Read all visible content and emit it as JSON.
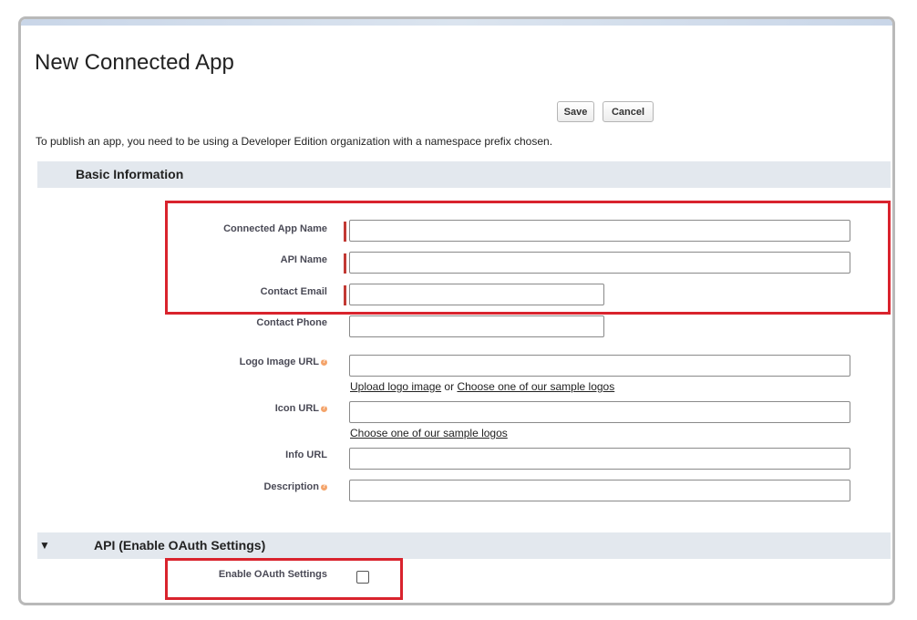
{
  "page": {
    "title": "New Connected App",
    "notice": "To publish an app, you need to be using a Developer Edition organization with a namespace prefix chosen."
  },
  "buttons": {
    "save": "Save",
    "cancel": "Cancel"
  },
  "sections": {
    "basic": {
      "title": "Basic Information"
    },
    "api": {
      "title": "API (Enable OAuth Settings)",
      "collapse_icon": "triangle-down-icon",
      "expanded": true
    }
  },
  "fields": {
    "connected_app_name": {
      "label": "Connected App Name",
      "value": "",
      "required": true
    },
    "api_name": {
      "label": "API Name",
      "value": "",
      "required": true
    },
    "contact_email": {
      "label": "Contact Email",
      "value": "",
      "required": true
    },
    "contact_phone": {
      "label": "Contact Phone",
      "value": ""
    },
    "logo_image_url": {
      "label": "Logo Image URL",
      "value": "",
      "help_icon": "info-icon"
    },
    "icon_url": {
      "label": "Icon URL",
      "value": "",
      "help_icon": "info-icon"
    },
    "info_url": {
      "label": "Info URL",
      "value": ""
    },
    "description": {
      "label": "Description",
      "value": "",
      "help_icon": "info-icon"
    },
    "enable_oauth": {
      "label": "Enable OAuth Settings",
      "checked": false
    }
  },
  "links": {
    "upload_logo": "Upload logo image",
    "or": "or",
    "choose_sample_logos": "Choose one of our sample logos",
    "icon_choose_sample_logos": "Choose one of our sample logos"
  },
  "colors": {
    "highlight": "#d9232d",
    "required": "#c23934",
    "section_bg": "#e3e8ee"
  }
}
